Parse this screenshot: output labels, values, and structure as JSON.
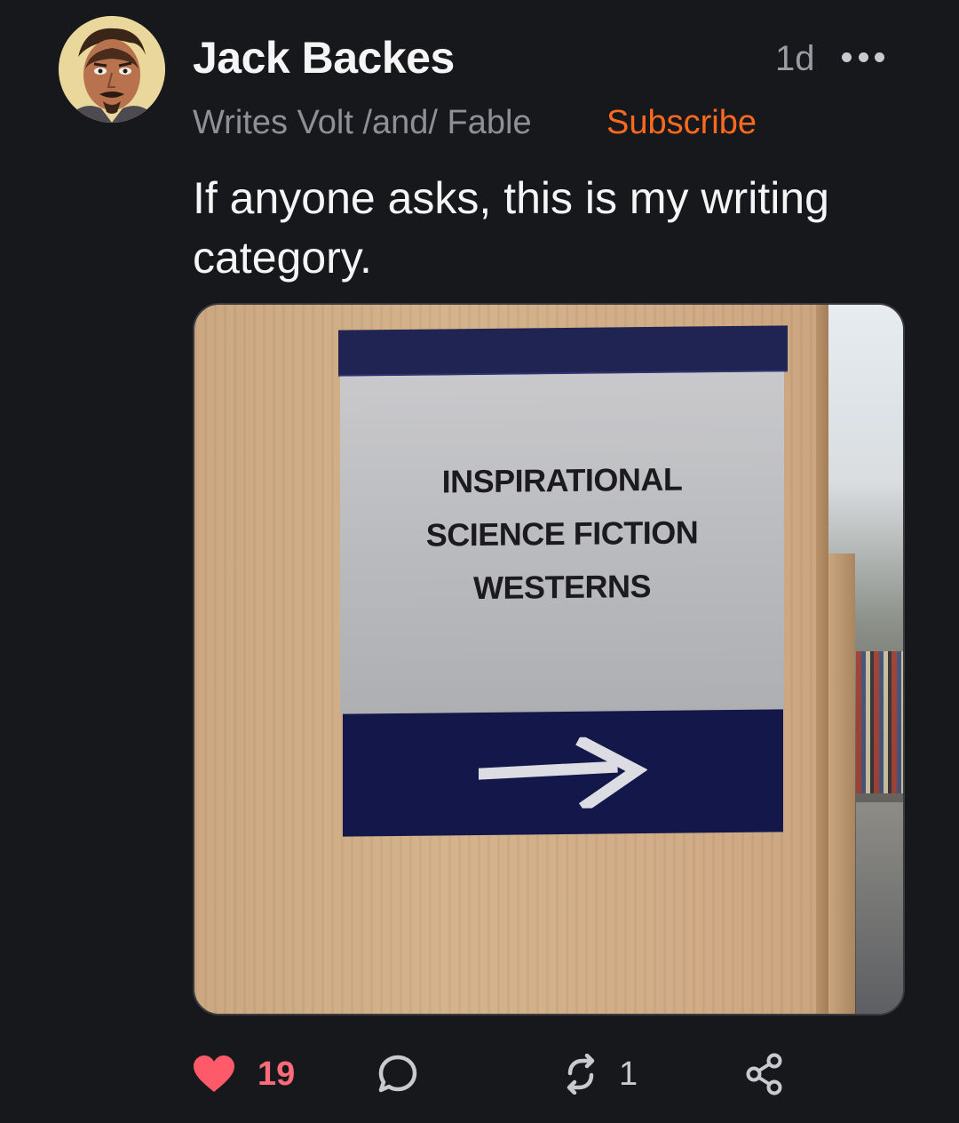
{
  "author": {
    "name": "Jack Backes",
    "tagline": "Writes Volt /and/ Fable",
    "subscribe_label": "Subscribe",
    "avatar_icon": "user-avatar-icon"
  },
  "post": {
    "timestamp": "1d",
    "more_icon": "more-horizontal-icon",
    "text": "If anyone asks, this is my writing category.",
    "image": {
      "sign_lines": [
        "INSPIRATIONAL",
        "SCIENCE FICTION",
        "WESTERNS"
      ],
      "arrow_icon": "arrow-right-icon"
    }
  },
  "actions": {
    "likes": "19",
    "restacks": "1",
    "like_icon": "heart-icon",
    "comment_icon": "comment-icon",
    "restack_icon": "restack-icon",
    "share_icon": "share-icon"
  },
  "colors": {
    "background": "#17181c",
    "accent": "#ff6a1f",
    "like": "#ff6b78",
    "sign_navy": "#1f2453"
  }
}
